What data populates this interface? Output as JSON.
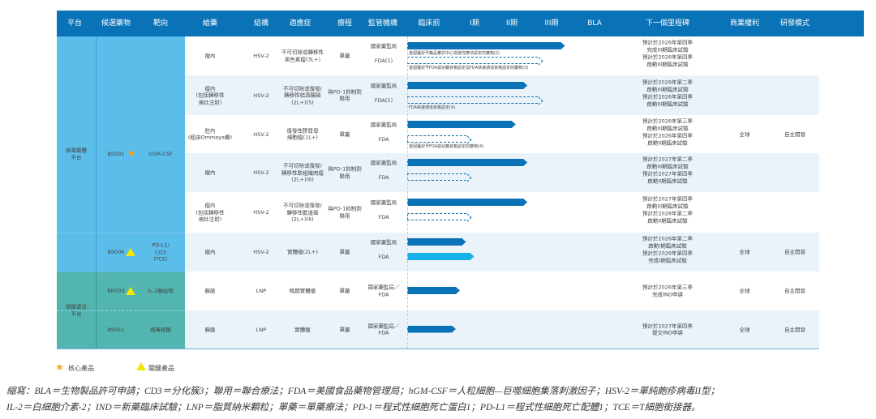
{
  "header": [
    "平台",
    "候選藥物",
    "靶向",
    "給藥",
    "結構",
    "適應症",
    "療程",
    "監管機構",
    "臨床前",
    "I期",
    "II期",
    "III期",
    "BLA",
    "下一個里程碑",
    "商業權利",
    "研發模式"
  ],
  "colors": {
    "header": "#0a72b6",
    "viral_platform": "#5bbdea",
    "nucleic_platform": "#53b5b0",
    "bar": "#0a72b6",
    "bar_fda_active": "#16b0ea",
    "star": "#f7a21b",
    "triangle": "#f5e600"
  },
  "platforms": [
    {
      "name": "病毒載體平台"
    },
    {
      "name": "核酸遞送平台"
    }
  ],
  "candidates": [
    {
      "name": "BS001",
      "marker": "star-icon",
      "target": "hGM-CSF"
    },
    {
      "name": "BS006",
      "marker": "triangle-icon",
      "target": "PD-L1/\nCD3\n(TCE)"
    },
    {
      "name": "BR003",
      "marker": "triangle-icon",
      "target": "IL-2類似物"
    },
    {
      "name": "BS051",
      "marker": "",
      "target": "病毒核酸"
    }
  ],
  "phase_scale": [
    "臨床前",
    "I期",
    "II期",
    "III期",
    "BLA"
  ],
  "rows": [
    {
      "admin": "瘤內",
      "structure": "HSV-2",
      "indication": "不可切除或轉移性\n黑色素瘤(3L+)",
      "regimen": "單藥",
      "rights": "",
      "mode": "",
      "tracks": [
        {
          "agency": "國家藥監局",
          "progress": 3.8,
          "style": "solid",
          "milestone": "預計於2026年第四季\n完成III期臨床試驗",
          "note": "首個獲授予藥品審評中心突破性療法認定的藥物(2)"
        },
        {
          "agency": "FDA(1)",
          "progress": 3.15,
          "style": "dash",
          "milestone": "預計於2026年第四季\n啟動III期臨床試驗",
          "note": "首個獲授予FDA孤兒藥資格認定及FDA快速通道資格認定的藥物(3)"
        }
      ]
    },
    {
      "admin": "瘤內\n(包括轉移性\n病灶注射)",
      "structure": "HSV-2",
      "indication": "不可切除或復發/\n轉移性結直腸癌\n(2L+)(5)",
      "regimen": "與PD-1抑制劑\n聯用",
      "rights": "",
      "mode": "",
      "tracks": [
        {
          "agency": "國家藥監局",
          "progress": 2.9,
          "style": "solid",
          "milestone": "預計於2026年第二季\n啟動III期臨床試驗",
          "note": ""
        },
        {
          "agency": "FDA(1)",
          "progress": 3.15,
          "style": "dash",
          "milestone": "預計於2026年第四季\n啟動III期臨床試驗",
          "note": "FDA快速通道資格認定(4)"
        }
      ]
    },
    {
      "admin": "腔內\n(經由Ommaya囊)",
      "structure": "HSV-2",
      "indication": "復發性膠質母\n細胞瘤(1L+)",
      "regimen": "單藥",
      "rights": "全球",
      "mode": "自主開發",
      "tracks": [
        {
          "agency": "國家藥監局",
          "progress": 2.6,
          "style": "solid",
          "milestone": "預計於2026年第三季\n啟動III期臨床試驗",
          "note": ""
        },
        {
          "agency": "FDA",
          "progress": 1.35,
          "style": "dash",
          "milestone": "預計於2026年第四季\n啟動II期臨床試驗",
          "note": "首個獲授予FDA孤兒藥資格認定的藥物(4)"
        }
      ]
    },
    {
      "admin": "瘤內",
      "structure": "HSV-2",
      "indication": "不可切除或復發/\n轉移性軟組織肉瘤\n(2L+)(6)",
      "regimen": "與PD-1抑制劑\n聯用",
      "rights": "",
      "mode": "",
      "tracks": [
        {
          "agency": "國家藥監局",
          "progress": 2.9,
          "style": "solid",
          "milestone": "預計於2027年第二季\n啟動III期臨床試驗",
          "note": ""
        },
        {
          "agency": "FDA",
          "progress": 1.35,
          "style": "dash",
          "milestone": "預計於2027年第四季\n啟動II期臨床試驗",
          "note": ""
        }
      ]
    },
    {
      "admin": "瘤內\n(包括轉移性\n病灶注射)",
      "structure": "HSV-2",
      "indication": "不可切除或復發/\n轉移性膽道癌\n(2L+)(6)",
      "regimen": "與PD-1抑制劑\n聯用",
      "rights": "",
      "mode": "",
      "tracks": [
        {
          "agency": "國家藥監局",
          "progress": 2.9,
          "style": "solid",
          "milestone": "預計於2027年第四季\n啟動III期臨床試驗",
          "note": ""
        },
        {
          "agency": "FDA",
          "progress": 1.35,
          "style": "dash",
          "milestone": "預計於2028年第二季\n啟動II期臨床試驗",
          "note": ""
        }
      ]
    },
    {
      "admin": "瘤內",
      "structure": "HSV-2",
      "indication": "實體瘤(2L+)",
      "regimen": "單藥",
      "rights": "全球",
      "mode": "自主開發",
      "tracks": [
        {
          "agency": "國家藥監局",
          "progress": 1.35,
          "style": "solid",
          "milestone": "預計於2026年第二季\n啟動I期臨床試驗",
          "note": ""
        },
        {
          "agency": "FDA",
          "progress": 1.55,
          "style": "cyan",
          "milestone": "預計於2026年第四季\n完成I期臨床試驗",
          "note": ""
        }
      ]
    },
    {
      "admin": "靜脈",
      "structure": "LNP",
      "indication": "晚期實體瘤",
      "regimen": "單藥",
      "rights": "全球",
      "mode": "自主開發",
      "tracks": [
        {
          "agency": "國家藥監局／\nFDA",
          "progress": 1.2,
          "style": "solid",
          "milestone": "預計於2026年第三季\n完成IND申請",
          "note": ""
        }
      ]
    },
    {
      "admin": "靜脈",
      "structure": "LNP",
      "indication": "實體瘤",
      "regimen": "單藥",
      "rights": "全球",
      "mode": "自主開發",
      "tracks": [
        {
          "agency": "國家藥監局／\nFDA",
          "progress": 1.1,
          "style": "solid",
          "milestone": "預計於2027年第四季\n提交IND申請",
          "note": ""
        }
      ]
    }
  ],
  "legend": {
    "core": "核心產品",
    "key": "關鍵產品"
  },
  "footnote": [
    "縮寫：BLA＝生物製品許可申請；CD3＝分化簇3；聯用＝聯合療法；FDA＝美國食品藥物管理局；hGM-CSF＝人粒細胞—巨噬細胞集落刺激因子；HSV-2＝單純皰疹病毒II型；",
    "IL-2＝白細胞介素-2；IND＝新藥臨床試驗；LNP＝脂質納米顆粒；單藥＝單藥療法；PD-1＝程式性細胞死亡蛋白1；PD-L1＝程式性細胞死亡配體1；TCE＝T細胞銜接器。"
  ]
}
